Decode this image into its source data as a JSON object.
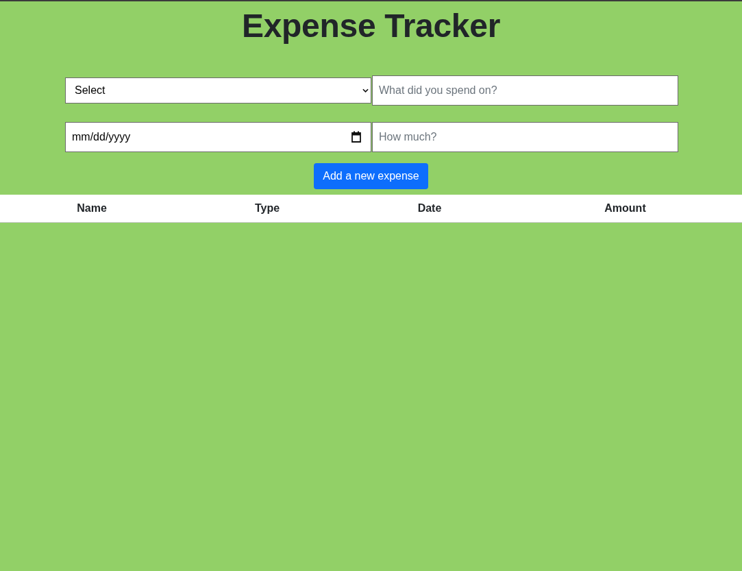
{
  "title": "Expense Tracker",
  "form": {
    "type_select": {
      "value": "Select"
    },
    "name_field": {
      "placeholder": "What did you spend on?"
    },
    "date_field": {
      "placeholder": "mm/dd/yyyy"
    },
    "amount_field": {
      "placeholder": "How much?"
    },
    "submit_button": {
      "label": "Add a new expense"
    }
  },
  "table": {
    "columns": [
      "Name",
      "Type",
      "Date",
      "Amount"
    ]
  }
}
